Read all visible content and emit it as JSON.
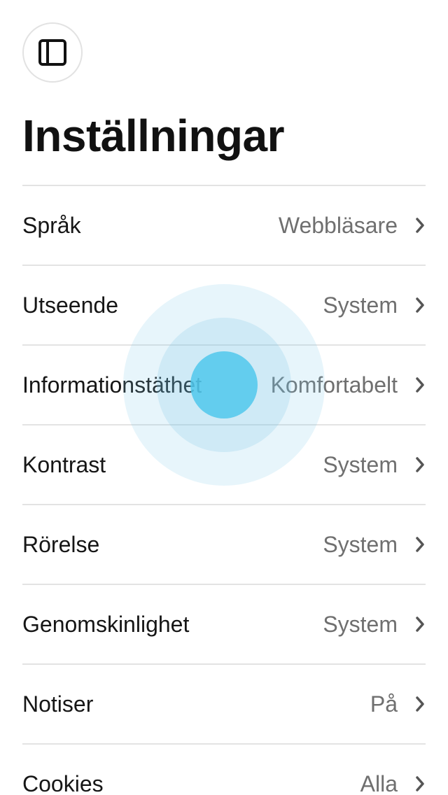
{
  "header": {
    "title": "Inställningar",
    "sidebar_icon": "sidebar-panel-icon"
  },
  "settings": {
    "items": [
      {
        "label": "Språk",
        "value": "Webbläsare"
      },
      {
        "label": "Utseende",
        "value": "System"
      },
      {
        "label": "Informationstäthet",
        "value": "Komfortabelt"
      },
      {
        "label": "Kontrast",
        "value": "System"
      },
      {
        "label": "Rörelse",
        "value": "System"
      },
      {
        "label": "Genomskinlighet",
        "value": "System"
      },
      {
        "label": "Notiser",
        "value": "På"
      },
      {
        "label": "Cookies",
        "value": "Alla"
      }
    ],
    "chevron_icon": "chevron-right-icon"
  },
  "colors": {
    "touch_indicator": "#5ccfee",
    "value_text": "#6f6f6f",
    "divider": "#e3e3e3"
  }
}
